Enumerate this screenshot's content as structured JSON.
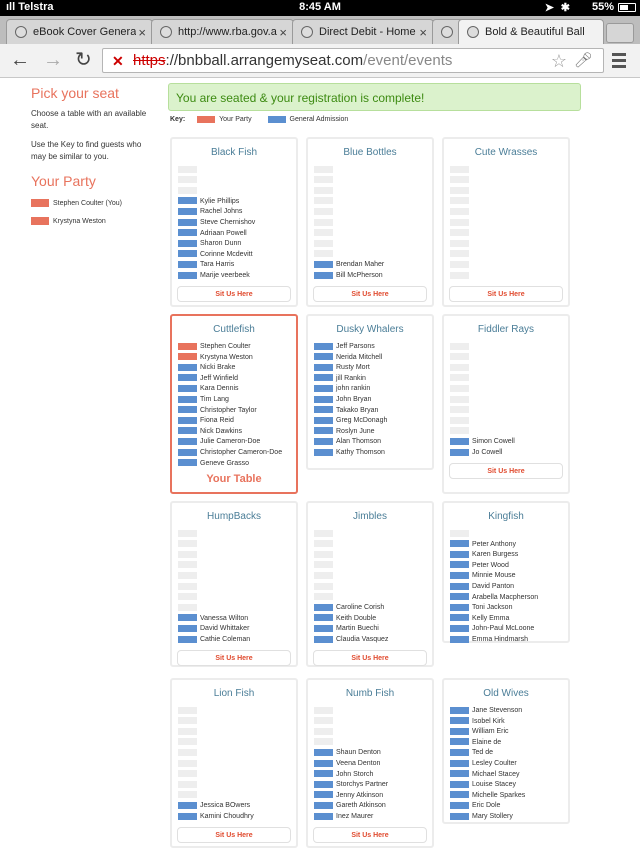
{
  "status_bar": {
    "carrier": "ıll Telstra",
    "time": "8:45 AM",
    "battery": "55%"
  },
  "tabs": [
    {
      "label": "eBook Cover Genera",
      "active": false
    },
    {
      "label": "http://www.rba.gov.a",
      "active": false
    },
    {
      "label": "Direct Debit - Home",
      "active": false
    },
    {
      "label": "",
      "active": false
    },
    {
      "label": "Bold & Beautiful Ball",
      "active": true
    }
  ],
  "toolbar": {
    "url_scheme": "https",
    "url_sep": "://",
    "url_host": "bnbball.arrangemyseat.com",
    "url_path": "/event/events"
  },
  "sidebar": {
    "pick_title": "Pick your seat",
    "instructions_1": "Choose a table with an available seat.",
    "instructions_2": "Use the Key to find guests who may be similar to you.",
    "party_title": "Your Party",
    "party": [
      "Stephen Coulter (You)",
      "Krystyna Weston"
    ]
  },
  "banner": "You are seated & your registration is complete!",
  "key": {
    "label": "Key:",
    "your_party": "Your Party",
    "general": "General Admission"
  },
  "colors": {
    "your_party": "#e8735d",
    "general_admission": "#5b8fd0",
    "empty": "#eeeeee",
    "title": "#4a7d97"
  },
  "sit_label": "Sit Us Here",
  "your_table_label": "Your Table",
  "tables": [
    {
      "name": "Black Fish",
      "seats": [
        {
          "t": "e",
          "n": ""
        },
        {
          "t": "e",
          "n": ""
        },
        {
          "t": "e",
          "n": ""
        },
        {
          "t": "g",
          "n": "Kylie Phillips"
        },
        {
          "t": "g",
          "n": "Rachel Johns"
        },
        {
          "t": "g",
          "n": "Steve Chernishov"
        },
        {
          "t": "g",
          "n": "Adriaan Powell"
        },
        {
          "t": "g",
          "n": "Sharon Dunn"
        },
        {
          "t": "g",
          "n": "Corinne Mcdevitt"
        },
        {
          "t": "g",
          "n": "Tara Harris"
        },
        {
          "t": "g",
          "n": "Marije veerbeek"
        }
      ],
      "button": true
    },
    {
      "name": "Blue Bottles",
      "seats": [
        {
          "t": "e",
          "n": ""
        },
        {
          "t": "e",
          "n": ""
        },
        {
          "t": "e",
          "n": ""
        },
        {
          "t": "e",
          "n": ""
        },
        {
          "t": "e",
          "n": ""
        },
        {
          "t": "e",
          "n": ""
        },
        {
          "t": "e",
          "n": ""
        },
        {
          "t": "e",
          "n": ""
        },
        {
          "t": "e",
          "n": ""
        },
        {
          "t": "g",
          "n": "Brendan Maher"
        },
        {
          "t": "g",
          "n": "Bill McPherson"
        }
      ],
      "button": true
    },
    {
      "name": "Cute Wrasses",
      "seats": [
        {
          "t": "e",
          "n": ""
        },
        {
          "t": "e",
          "n": ""
        },
        {
          "t": "e",
          "n": ""
        },
        {
          "t": "e",
          "n": ""
        },
        {
          "t": "e",
          "n": ""
        },
        {
          "t": "e",
          "n": ""
        },
        {
          "t": "e",
          "n": ""
        },
        {
          "t": "e",
          "n": ""
        },
        {
          "t": "e",
          "n": ""
        },
        {
          "t": "e",
          "n": ""
        },
        {
          "t": "e",
          "n": ""
        }
      ],
      "button": true
    },
    {
      "name": "Cuttlefish",
      "mine": true,
      "seats": [
        {
          "t": "y",
          "n": "Stephen Coulter"
        },
        {
          "t": "y",
          "n": "Krystyna Weston"
        },
        {
          "t": "g",
          "n": "Nicki Brake"
        },
        {
          "t": "g",
          "n": "Jeff Winfield"
        },
        {
          "t": "g",
          "n": "Kara Dennis"
        },
        {
          "t": "g",
          "n": "Tim Lang"
        },
        {
          "t": "g",
          "n": "Christopher Taylor"
        },
        {
          "t": "g",
          "n": "Fiona Reid"
        },
        {
          "t": "g",
          "n": "Nick Dawkins"
        },
        {
          "t": "g",
          "n": "Julie Cameron-Doe"
        },
        {
          "t": "g",
          "n": "Christopher Cameron-Doe"
        },
        {
          "t": "g",
          "n": "Geneve Grasso"
        }
      ],
      "button": false
    },
    {
      "name": "Dusky Whalers",
      "seats": [
        {
          "t": "g",
          "n": "Jeff Parsons"
        },
        {
          "t": "g",
          "n": "Nerida Mitchell"
        },
        {
          "t": "g",
          "n": "Rusty Mort"
        },
        {
          "t": "g",
          "n": "jill Rankin"
        },
        {
          "t": "g",
          "n": "john rankin"
        },
        {
          "t": "g",
          "n": "John Bryan"
        },
        {
          "t": "g",
          "n": "Takako Bryan"
        },
        {
          "t": "g",
          "n": "Greg McDonagh"
        },
        {
          "t": "g",
          "n": "Roslyn June"
        },
        {
          "t": "g",
          "n": "Alan Thomson"
        },
        {
          "t": "g",
          "n": "Kathy Thomson"
        }
      ],
      "button": false
    },
    {
      "name": "Fiddler Rays",
      "seats": [
        {
          "t": "e",
          "n": ""
        },
        {
          "t": "e",
          "n": ""
        },
        {
          "t": "e",
          "n": ""
        },
        {
          "t": "e",
          "n": ""
        },
        {
          "t": "e",
          "n": ""
        },
        {
          "t": "e",
          "n": ""
        },
        {
          "t": "e",
          "n": ""
        },
        {
          "t": "e",
          "n": ""
        },
        {
          "t": "e",
          "n": ""
        },
        {
          "t": "g",
          "n": "Simon Cowell"
        },
        {
          "t": "g",
          "n": "Jo Cowell"
        }
      ],
      "button": true
    },
    {
      "name": "HumpBacks",
      "seats": [
        {
          "t": "e",
          "n": ""
        },
        {
          "t": "e",
          "n": ""
        },
        {
          "t": "e",
          "n": ""
        },
        {
          "t": "e",
          "n": ""
        },
        {
          "t": "e",
          "n": ""
        },
        {
          "t": "e",
          "n": ""
        },
        {
          "t": "e",
          "n": ""
        },
        {
          "t": "e",
          "n": ""
        },
        {
          "t": "g",
          "n": "Vanessa Wilton"
        },
        {
          "t": "g",
          "n": "David Whittaker"
        },
        {
          "t": "g",
          "n": "Cathie Coleman"
        }
      ],
      "button": true
    },
    {
      "name": "Jimbles",
      "seats": [
        {
          "t": "e",
          "n": ""
        },
        {
          "t": "e",
          "n": ""
        },
        {
          "t": "e",
          "n": ""
        },
        {
          "t": "e",
          "n": ""
        },
        {
          "t": "e",
          "n": ""
        },
        {
          "t": "e",
          "n": ""
        },
        {
          "t": "e",
          "n": ""
        },
        {
          "t": "g",
          "n": "Caroline Corish"
        },
        {
          "t": "g",
          "n": "Keith Double"
        },
        {
          "t": "g",
          "n": "Martin Buechi"
        },
        {
          "t": "g",
          "n": "Claudia Vasquez"
        }
      ],
      "button": true
    },
    {
      "name": "Kingfish",
      "seats": [
        {
          "t": "e",
          "n": ""
        },
        {
          "t": "g",
          "n": "Peter Anthony"
        },
        {
          "t": "g",
          "n": "Karen Burgess"
        },
        {
          "t": "g",
          "n": "Peter Wood"
        },
        {
          "t": "g",
          "n": "Minnie Mouse"
        },
        {
          "t": "g",
          "n": "David Panton"
        },
        {
          "t": "g",
          "n": "Arabella Macpherson"
        },
        {
          "t": "g",
          "n": "Toni Jackson"
        },
        {
          "t": "g",
          "n": "Kelly Emma"
        },
        {
          "t": "g",
          "n": "John-Paul McLoone"
        },
        {
          "t": "g",
          "n": "Emma Hindmarsh"
        }
      ],
      "button": false
    },
    {
      "name": "Lion Fish",
      "seats": [
        {
          "t": "e",
          "n": ""
        },
        {
          "t": "e",
          "n": ""
        },
        {
          "t": "e",
          "n": ""
        },
        {
          "t": "e",
          "n": ""
        },
        {
          "t": "e",
          "n": ""
        },
        {
          "t": "e",
          "n": ""
        },
        {
          "t": "e",
          "n": ""
        },
        {
          "t": "e",
          "n": ""
        },
        {
          "t": "e",
          "n": ""
        },
        {
          "t": "g",
          "n": "Jessica BOwers"
        },
        {
          "t": "g",
          "n": "Kamini Choudhry"
        }
      ],
      "button": true
    },
    {
      "name": "Numb Fish",
      "seats": [
        {
          "t": "e",
          "n": ""
        },
        {
          "t": "e",
          "n": ""
        },
        {
          "t": "e",
          "n": ""
        },
        {
          "t": "e",
          "n": ""
        },
        {
          "t": "g",
          "n": "Shaun Denton"
        },
        {
          "t": "g",
          "n": "Veena Denton"
        },
        {
          "t": "g",
          "n": "John Storch"
        },
        {
          "t": "g",
          "n": "Storchys Partner"
        },
        {
          "t": "g",
          "n": "Jenny Atkinson"
        },
        {
          "t": "g",
          "n": "Gareth Atkinson"
        },
        {
          "t": "g",
          "n": "Inez Maurer"
        }
      ],
      "button": true
    },
    {
      "name": "Old Wives",
      "seats": [
        {
          "t": "g",
          "n": "Jane Stevenson"
        },
        {
          "t": "g",
          "n": "Isobel Kirk"
        },
        {
          "t": "g",
          "n": "William Eric"
        },
        {
          "t": "g",
          "n": "Elaine de"
        },
        {
          "t": "g",
          "n": "Ted de"
        },
        {
          "t": "g",
          "n": "Lesley Coulter"
        },
        {
          "t": "g",
          "n": "Michael Stacey"
        },
        {
          "t": "g",
          "n": "Louise Stacey"
        },
        {
          "t": "g",
          "n": "Michelle Sparkes"
        },
        {
          "t": "g",
          "n": "Eric Dole"
        },
        {
          "t": "g",
          "n": "Mary Stollery"
        }
      ],
      "button": false
    }
  ]
}
